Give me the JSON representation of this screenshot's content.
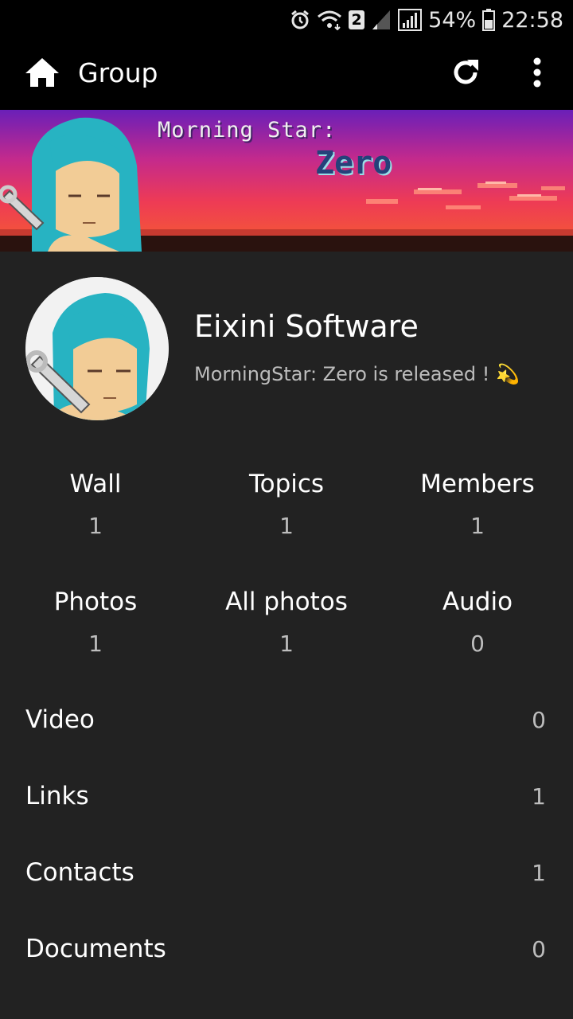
{
  "status_bar": {
    "sim_badge": "2",
    "battery": "54%",
    "time": "22:58",
    "icons": [
      "alarm-icon",
      "wifi-icon",
      "signal-empty-icon",
      "signal-icon",
      "battery-icon"
    ]
  },
  "app_bar": {
    "title": "Group",
    "icons": [
      "home-icon",
      "refresh-icon",
      "more-vert-icon"
    ]
  },
  "banner": {
    "line1": "Morning Star:",
    "line2": "Zero"
  },
  "group": {
    "name": "Eixini Software",
    "status": "MorningStar: Zero is released ! 💫"
  },
  "counters": [
    {
      "label": "Wall",
      "value": "1"
    },
    {
      "label": "Topics",
      "value": "1"
    },
    {
      "label": "Members",
      "value": "1"
    },
    {
      "label": "Photos",
      "value": "1"
    },
    {
      "label": "All photos",
      "value": "1"
    },
    {
      "label": "Audio",
      "value": "0"
    }
  ],
  "list": [
    {
      "label": "Video",
      "value": "0"
    },
    {
      "label": "Links",
      "value": "1"
    },
    {
      "label": "Contacts",
      "value": "1"
    },
    {
      "label": "Documents",
      "value": "0"
    }
  ],
  "colors": {
    "background": "#222222",
    "bars": "#000000",
    "text": "#ffffff",
    "secondary_text": "#bdbdbd",
    "avatar_hair": "#27b3c2"
  }
}
